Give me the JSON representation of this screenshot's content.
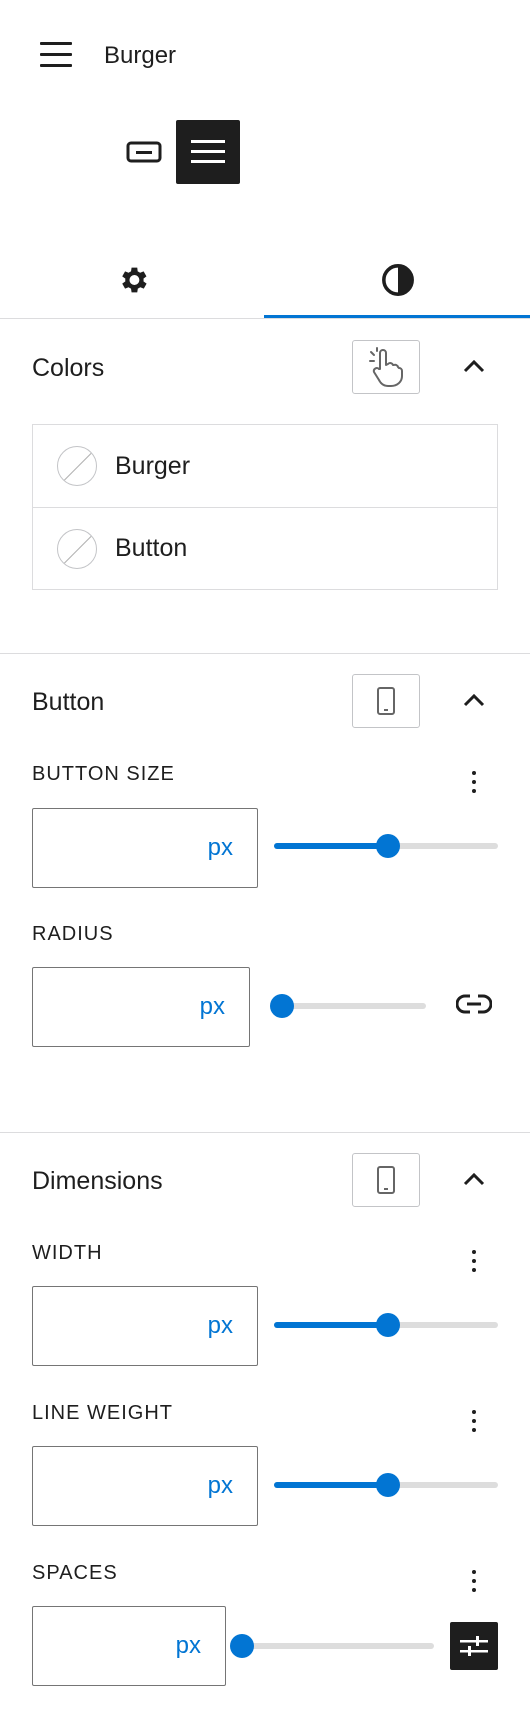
{
  "header": {
    "title": "Burger",
    "icon": "menu-icon"
  },
  "variants": [
    {
      "name": "button-variant-icon",
      "selected": false
    },
    {
      "name": "burger-variant-icon",
      "selected": true
    }
  ],
  "tabs": [
    {
      "name": "settings",
      "icon": "gear-icon",
      "selected": false
    },
    {
      "name": "styles",
      "icon": "contrast-icon",
      "selected": true
    }
  ],
  "colors_panel": {
    "title": "Colors",
    "state_icon": "hand-pointer-icon",
    "items": [
      {
        "label": "Burger"
      },
      {
        "label": "Button"
      }
    ]
  },
  "button_panel": {
    "title": "Button",
    "device_icon": "mobile-icon",
    "button_size": {
      "label": "BUTTON SIZE",
      "value": "",
      "unit": "px",
      "slider_fraction": 0.5
    },
    "radius": {
      "label": "RADIUS",
      "value": "",
      "unit": "px",
      "slider_fraction": 0.0
    }
  },
  "dimensions_panel": {
    "title": "Dimensions",
    "device_icon": "mobile-icon",
    "width": {
      "label": "WIDTH",
      "value": "",
      "unit": "px",
      "slider_fraction": 0.5
    },
    "line_weight": {
      "label": "LINE WEIGHT",
      "value": "",
      "unit": "px",
      "slider_fraction": 0.5
    },
    "spaces": {
      "label": "SPACES",
      "value": "",
      "unit": "px",
      "slider_fraction": 0.0
    }
  },
  "colors": {
    "accent": "#0275d3",
    "text": "#1e1e1e",
    "border": "#dcdcde"
  }
}
